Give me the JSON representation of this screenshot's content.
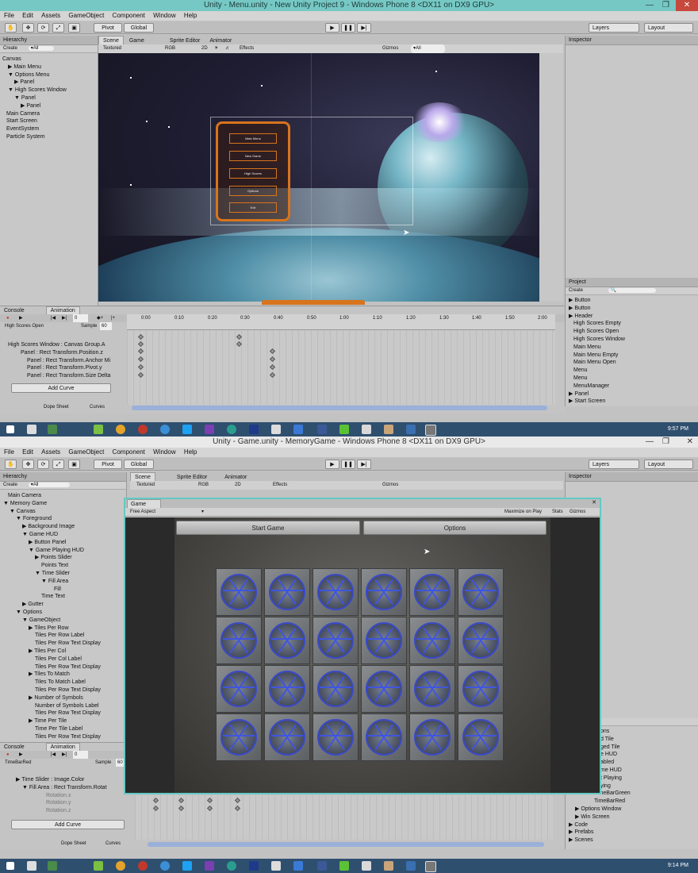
{
  "top_window": {
    "title": "Unity - Menu.unity - New Unity Project 9 - Windows Phone 8 <DX11 on DX9 GPU>",
    "menu": [
      "File",
      "Edit",
      "Assets",
      "GameObject",
      "Component",
      "Window",
      "Help"
    ],
    "toolbar": {
      "pivot": "Pivot",
      "global": "Global",
      "layers": "Layers",
      "layout": "Layout"
    },
    "hierarchy": {
      "title": "Hierarchy",
      "create": "Create",
      "search": "▾All",
      "items": [
        "Canvas",
        "▶ Main Menu",
        "▼ Options Menu",
        "▶ Panel",
        "▼ High Scores Window",
        "▼ Panel",
        "▶ Panel",
        "Main Camera",
        "Start Screen",
        "EventSystem",
        "Particle System"
      ]
    },
    "scene_tabs": [
      "Scene",
      "Game",
      "Sprite Editor",
      "Animator"
    ],
    "scene_bar": {
      "textured": "Textured",
      "rgb": "RGB",
      "two_d": "2D",
      "effects": "Effects",
      "gizmos": "Gizmos",
      "search": "▾All"
    },
    "menu_buttons": [
      "Main Menu",
      "New Game",
      "High Scores",
      "Options",
      "Exit"
    ],
    "inspector": {
      "title": "Inspector"
    },
    "project": {
      "title": "Project",
      "create": "Create",
      "items": [
        "▶ Button",
        "▶ Button",
        "▶ Header",
        "High Scores Empty",
        "High Scores Open",
        "High Scores Window",
        "Main Menu",
        "Main Menu Empty",
        "Main Menu Open",
        "Menu",
        "Menu",
        "MenuManager",
        "▶ Panel",
        "▶ Start Screen"
      ]
    },
    "animation": {
      "tabs": [
        "Console",
        "Animation"
      ],
      "clip": "High Scores Open",
      "sample_label": "Sample",
      "sample": "60",
      "frame": "0",
      "ruler": [
        "0:00",
        "0:10",
        "0:20",
        "0:30",
        "0:40",
        "0:50",
        "1:00",
        "1:10",
        "1:20",
        "1:30",
        "1:40",
        "1:50",
        "2:00"
      ],
      "props": [
        "High Scores Window : Canvas Group.A",
        "Panel : Rect Transform.Position.z",
        "Panel : Rect Transform.Anchor Mi",
        "Panel : Rect Transform.Pivot.y",
        "Panel : Rect Transform.Size Delta"
      ],
      "add_curve": "Add Curve",
      "dope": "Dope Sheet",
      "curves": "Curves"
    },
    "clock": "9:57 PM"
  },
  "bottom_window": {
    "title": "Unity - Game.unity - MemoryGame - Windows Phone 8 <DX11 on DX9 GPU>",
    "menu": [
      "File",
      "Edit",
      "Assets",
      "GameObject",
      "Component",
      "Window",
      "Help"
    ],
    "toolbar": {
      "pivot": "Pivot",
      "global": "Global",
      "layers": "Layers",
      "layout": "Layout"
    },
    "hierarchy": {
      "title": "Hierarchy",
      "create": "Create",
      "search": "▾All",
      "items": [
        "Main Camera",
        "▼ Memory Game",
        "▼ Canvas",
        "▼ Foreground",
        "▶ Background Image",
        "▼ Game HUD",
        "▶ Button Panel",
        "▼ Game Playing HUD",
        "▶ Points Slider",
        "Points Text",
        "▼ Time Slider",
        "▼ Fill Area",
        "Fill",
        "Time Text",
        "▶ Gutter",
        "▼ Options",
        "▼ GameObject",
        "▶ Tiles Per Row",
        "Tiles Per Row Label",
        "Tiles Per Row Text Display",
        "▶ Tiles Per Col",
        "Tiles Per Col Label",
        "Tiles Per Row Text Display",
        "▶ Tiles To Match",
        "Tiles To Match Label",
        "Tiles Per Row Text Display",
        "▶ Number of Symbols",
        "Number of Symbols Label",
        "Tiles Per Row Text Display",
        "▶ Time Per Tile",
        "Time Per Tile Label",
        "Tiles Per Row Text Display"
      ]
    },
    "scene_tabs": [
      "Scene",
      "Sprite Editor",
      "Animator"
    ],
    "scene_bar": {
      "textured": "Textured",
      "rgb": "RGB",
      "two_d": "2D",
      "effects": "Effects",
      "gizmos": "Gizmos"
    },
    "game": {
      "tab": "Game",
      "aspect": "Free Aspect",
      "maximize": "Maximize on Play",
      "stats": "Stats",
      "gizmos": "Gizmos",
      "start_button": "Start Game",
      "options_button": "Options",
      "grid_rows": 4,
      "grid_cols": 6
    },
    "inspector": {
      "title": "Inspector"
    },
    "project": {
      "items": [
        "ons",
        "d Tile",
        "ged Tile",
        "e HUD",
        "abled",
        "me HUD",
        "t Playing",
        "ying",
        "TimeBarGreen",
        "TimeBarRed",
        "▶ Options Window",
        "▶ Win Screen",
        "▶ Code",
        "▶ Prefabs",
        "▶ Scenes"
      ]
    },
    "animation": {
      "tabs": [
        "Console",
        "Animation"
      ],
      "clip": "TimeBarRed",
      "sample_label": "Sample",
      "sample": "60",
      "frame": "0",
      "props": [
        "▶ Time Slider : Image.Color",
        "▼ Fill Area : Rect Transform.Rotat",
        "Rotation.x",
        "Rotation.y",
        "Rotation.z"
      ],
      "add_curve": "Add Curve",
      "dope": "Dope Sheet",
      "curves": "Curves"
    },
    "clock": "9:14 PM"
  },
  "colors": {
    "title_bar": "#76c8c4",
    "game_border": "#63c9c4",
    "taskbar": "#2f4f6f",
    "tile_symbol": "#3f55e0",
    "menu_orange": "#d8741c"
  }
}
